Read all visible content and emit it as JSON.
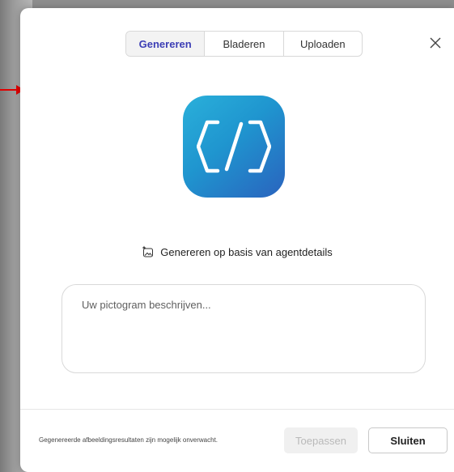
{
  "tabs": [
    {
      "label": "Genereren",
      "active": true
    },
    {
      "label": "Bladeren",
      "active": false
    },
    {
      "label": "Uploaden",
      "active": false
    }
  ],
  "icons": {
    "close": "close-icon",
    "agent": "code-brackets-icon",
    "generate": "image-sparkle-icon",
    "annotation": "red-arrow-icon"
  },
  "generate_label": "Genereren op basis van agentdetails",
  "description_placeholder": "Uw pictogram beschrijven...",
  "footer": {
    "disclaimer": "Gegenereerde afbeeldingsresultaten zijn mogelijk onverwacht.",
    "apply_label": "Toepassen",
    "close_label": "Sluiten"
  },
  "colors": {
    "accent": "#3c3eb5",
    "icon_gradient_start": "#2ab0da",
    "icon_gradient_end": "#2a63be",
    "annotation_arrow": "#e00000"
  }
}
